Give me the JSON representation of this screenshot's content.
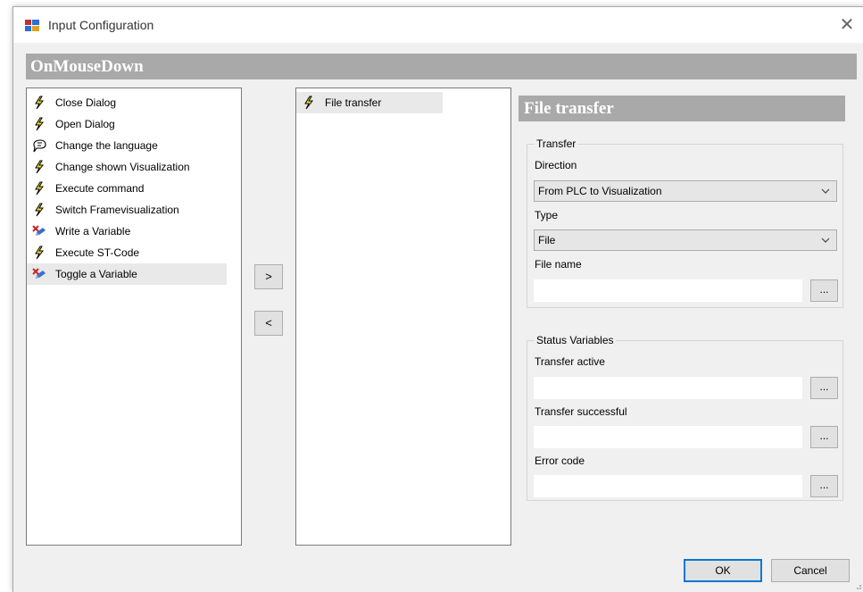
{
  "window": {
    "title": "Input Configuration",
    "close_glyph": "✕"
  },
  "event_header": "OnMouseDown",
  "available_actions": [
    {
      "label": "Close Dialog",
      "icon": "lightning-icon"
    },
    {
      "label": "Open Dialog",
      "icon": "lightning-icon"
    },
    {
      "label": "Change the language",
      "icon": "speech-bubble-icon"
    },
    {
      "label": "Change shown Visualization",
      "icon": "lightning-icon"
    },
    {
      "label": "Execute command",
      "icon": "lightning-icon"
    },
    {
      "label": "Switch Framevisualization",
      "icon": "lightning-icon"
    },
    {
      "label": "Write a Variable",
      "icon": "write-variable-icon"
    },
    {
      "label": "Execute ST-Code",
      "icon": "lightning-icon"
    },
    {
      "label": "Toggle a Variable",
      "icon": "write-variable-icon",
      "selected": true
    }
  ],
  "buttons": {
    "add": ">",
    "remove": "<",
    "ok": "OK",
    "cancel": "Cancel",
    "browse": "..."
  },
  "configured_actions": [
    {
      "label": "File transfer",
      "icon": "lightning-icon",
      "selected": true
    }
  ],
  "properties": {
    "header": "File transfer",
    "transfer_group": {
      "legend": "Transfer",
      "direction_label": "Direction",
      "direction_value": "From PLC to Visualization",
      "type_label": "Type",
      "type_value": "File",
      "filename_label": "File name",
      "filename_value": ""
    },
    "status_group": {
      "legend": "Status Variables",
      "active_label": "Transfer active",
      "active_value": "",
      "successful_label": "Transfer successful",
      "successful_value": "",
      "error_label": "Error code",
      "error_value": ""
    }
  },
  "colors": {
    "header_bg": "#a9a9a9",
    "dialog_bg": "#f0f0f0",
    "ok_border": "#0078d7",
    "lightning": "#f2e22a"
  }
}
